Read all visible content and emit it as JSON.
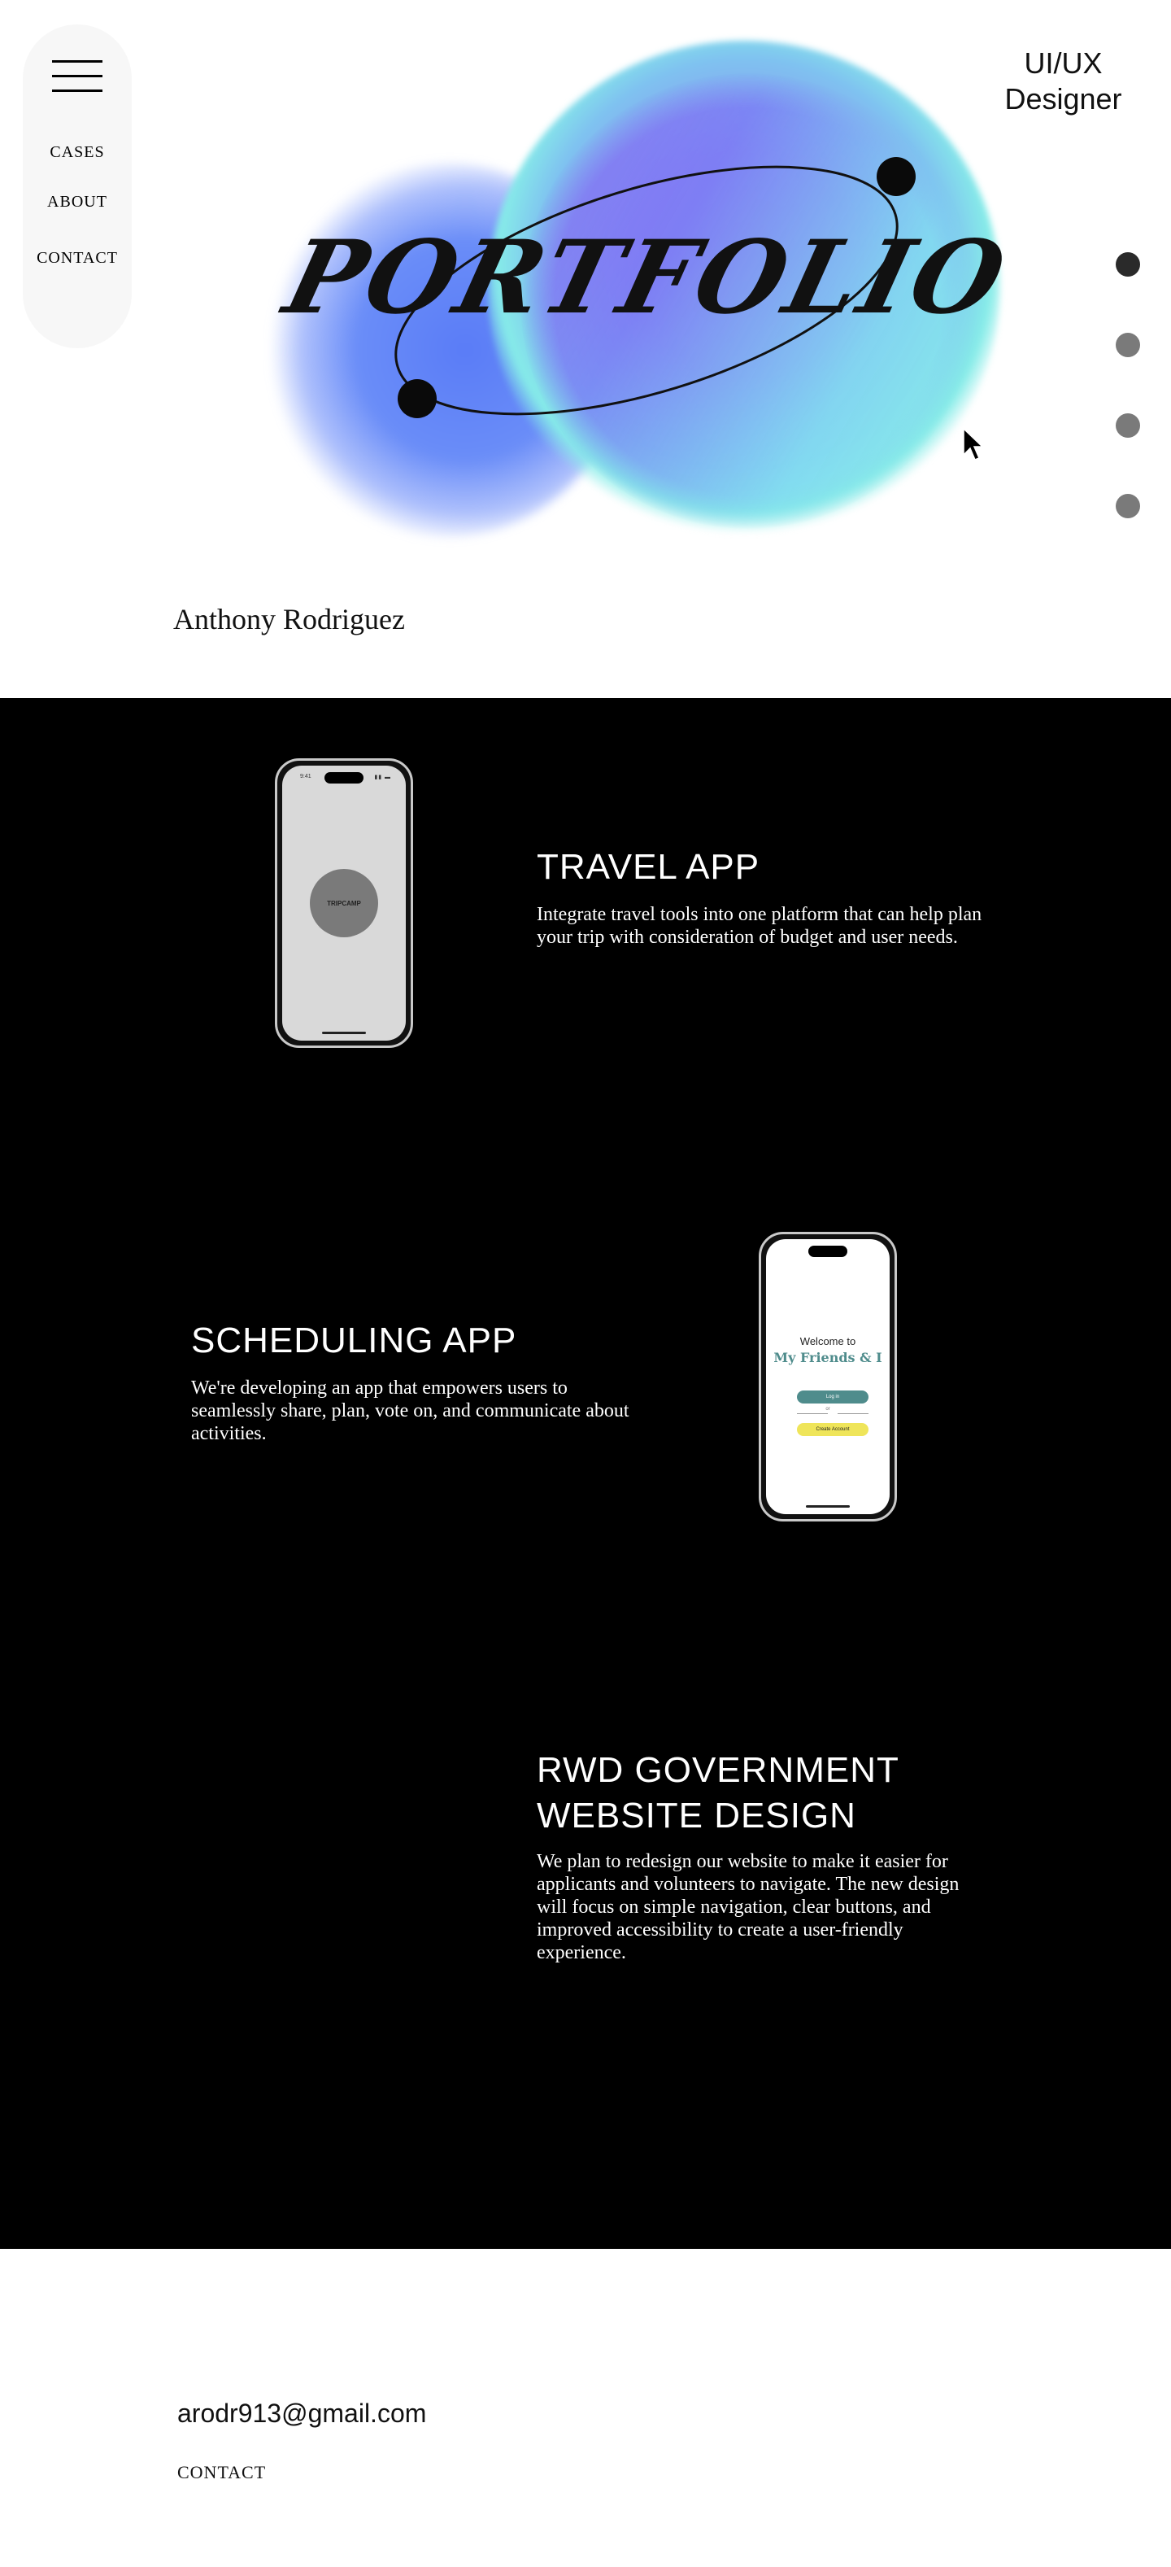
{
  "nav": {
    "items": [
      {
        "label": "CASES"
      },
      {
        "label": "ABOUT"
      },
      {
        "label": "CONTACT"
      }
    ]
  },
  "hero": {
    "title": "PORTFOLIO",
    "role": "UI/UX\nDesigner",
    "role_line1": "UI/UX",
    "role_line2": "Designer",
    "author": "Anthony Rodriguez",
    "section_dots": {
      "count": 4,
      "active_index": 0
    }
  },
  "colors": {
    "background": "#ffffff",
    "projects_bg": "#000000",
    "blob_blue": "#5a7cf7",
    "blob_purple": "#8f86ee",
    "blob_cyan": "#86ece8",
    "teal_accent": "#4f8c8c",
    "yellow_accent": "#efe55a"
  },
  "projects": [
    {
      "title": "TRAVEL APP",
      "description": "Integrate travel tools into one platform that can help plan your trip with consideration of budget and user needs.",
      "phone": {
        "status_time": "9:41",
        "splash_label": "TRIPCAMP"
      }
    },
    {
      "title": "SCHEDULING APP",
      "description": "We're developing an app that empowers users to seamlessly share, plan, vote on, and communicate about activities.",
      "phone": {
        "welcome": "Welcome to",
        "app_name": "My Friends & I",
        "login_label": "Log in",
        "or_label": "or",
        "create_label": "Create Account"
      }
    },
    {
      "title_line1": "RWD GOVERNMENT",
      "title_line2": "WEBSITE DESIGN",
      "description": "We plan to redesign our website to make it easier for applicants and volunteers to navigate. The new design will focus on simple navigation, clear buttons, and improved accessibility to create a user-friendly experience."
    }
  ],
  "footer": {
    "email": "arodr913@gmail.com",
    "contact_label": "CONTACT"
  }
}
